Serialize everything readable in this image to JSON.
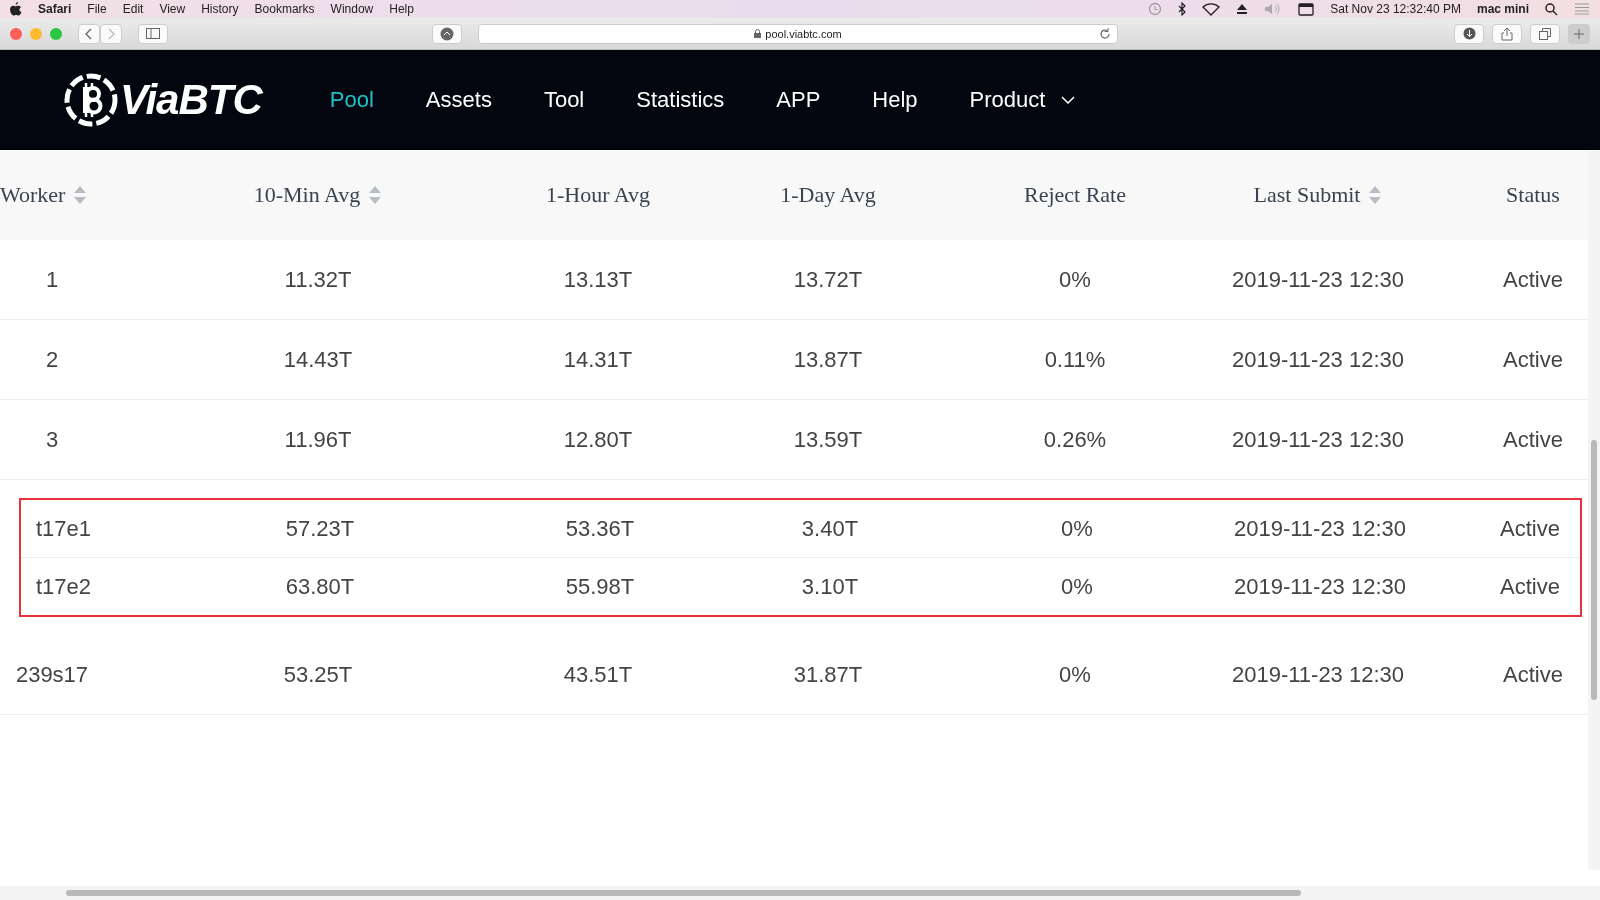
{
  "menubar": {
    "app": "Safari",
    "items": [
      "File",
      "Edit",
      "View",
      "History",
      "Bookmarks",
      "Window",
      "Help"
    ],
    "clock": "Sat Nov 23  12:32:40 PM",
    "user": "mac mini"
  },
  "browser": {
    "url": "pool.viabtc.com"
  },
  "nav": {
    "logo": "ViaBTC",
    "items": [
      {
        "label": "Pool",
        "selected": true,
        "dropdown": false
      },
      {
        "label": "Assets",
        "selected": false,
        "dropdown": false
      },
      {
        "label": "Tool",
        "selected": false,
        "dropdown": false
      },
      {
        "label": "Statistics",
        "selected": false,
        "dropdown": false
      },
      {
        "label": "APP",
        "selected": false,
        "dropdown": false
      },
      {
        "label": "Help",
        "selected": false,
        "dropdown": false
      },
      {
        "label": "Product",
        "selected": false,
        "dropdown": true
      }
    ]
  },
  "table": {
    "columns": [
      {
        "label": "Worker",
        "sortable": true
      },
      {
        "label": "10-Min Avg",
        "sortable": true
      },
      {
        "label": "1-Hour Avg",
        "sortable": false
      },
      {
        "label": "1-Day Avg",
        "sortable": false
      },
      {
        "label": "Reject Rate",
        "sortable": false
      },
      {
        "label": "Last Submit",
        "sortable": true
      },
      {
        "label": "Status",
        "sortable": false
      }
    ],
    "rows": [
      {
        "cells": [
          "1",
          "11.32T",
          "13.13T",
          "13.72T",
          "0%",
          "2019-11-23 12:30",
          "Active"
        ],
        "highlighted": false
      },
      {
        "cells": [
          "2",
          "14.43T",
          "14.31T",
          "13.87T",
          "0.11%",
          "2019-11-23 12:30",
          "Active"
        ],
        "highlighted": false
      },
      {
        "cells": [
          "3",
          "11.96T",
          "12.80T",
          "13.59T",
          "0.26%",
          "2019-11-23 12:30",
          "Active"
        ],
        "highlighted": false
      },
      {
        "cells": [
          "t17e1",
          "57.23T",
          "53.36T",
          "3.40T",
          "0%",
          "2019-11-23 12:30",
          "Active"
        ],
        "highlighted": true
      },
      {
        "cells": [
          "t17e2",
          "63.80T",
          "55.98T",
          "3.10T",
          "0%",
          "2019-11-23 12:30",
          "Active"
        ],
        "highlighted": true
      },
      {
        "cells": [
          "239s17",
          "53.25T",
          "43.51T",
          "31.87T",
          "0%",
          "2019-11-23 12:30",
          "Active"
        ],
        "highlighted": false
      }
    ]
  }
}
